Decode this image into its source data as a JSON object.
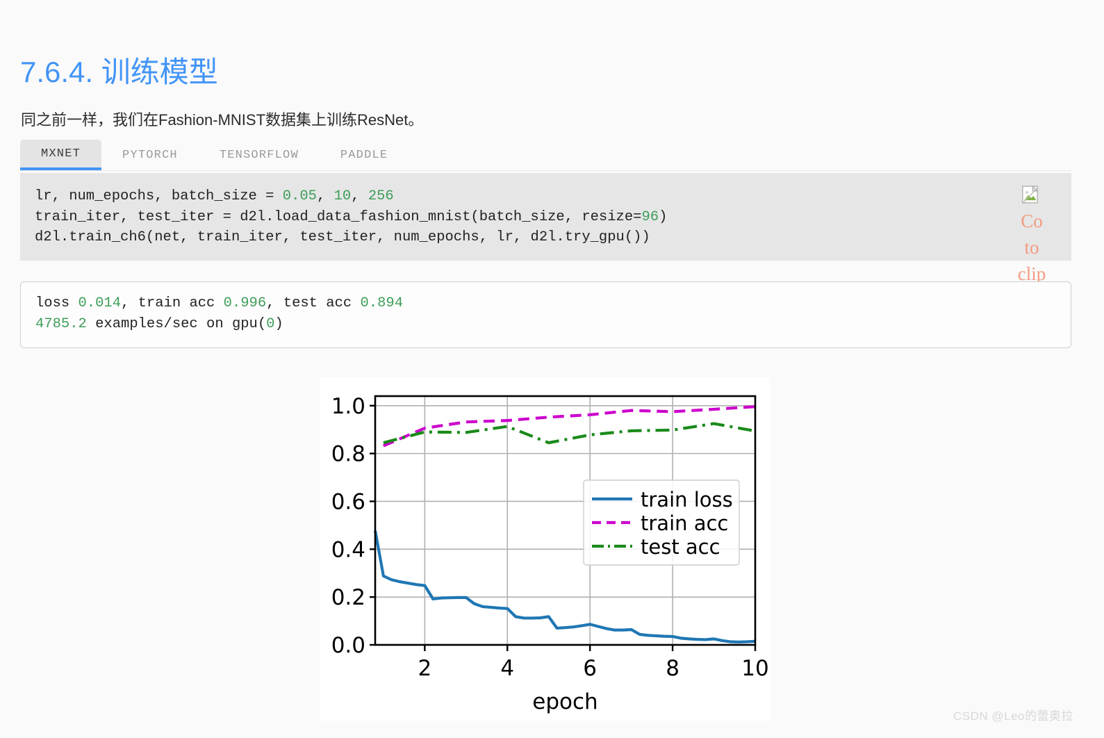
{
  "heading": "7.6.4. 训练模型",
  "paragraph": "同之前一样，我们在Fashion-MNIST数据集上训练ResNet。",
  "tabs": [
    {
      "label": "MXNET",
      "active": true
    },
    {
      "label": "PYTORCH",
      "active": false
    },
    {
      "label": "TENSORFLOW",
      "active": false
    },
    {
      "label": "PADDLE",
      "active": false
    }
  ],
  "code": {
    "line1_a": "lr, num_epochs, batch_size = ",
    "line1_n1": "0.05",
    "line1_b": ", ",
    "line1_n2": "10",
    "line1_c": ", ",
    "line1_n3": "256",
    "line2_a": "train_iter, test_iter = d2l.load_data_fashion_mnist(batch_size, resize=",
    "line2_n1": "96",
    "line2_b": ")",
    "line3": "d2l.train_ch6(net, train_iter, test_iter, num_epochs, lr, d2l.try_gpu())"
  },
  "copy_widget": {
    "icon": "broken-image-icon",
    "text_line1": "Co",
    "text_line2": "to",
    "text_line3": "clip"
  },
  "output": {
    "l1_a": "loss ",
    "l1_n1": "0.014",
    "l1_b": ", train acc ",
    "l1_n2": "0.996",
    "l1_c": ", test acc ",
    "l1_n3": "0.894",
    "l2_n1": "4785.2",
    "l2_a": " examples/sec on gpu(",
    "l2_n2": "0",
    "l2_b": ")"
  },
  "watermark": "CSDN @Leo的蕾奥拉",
  "colors": {
    "heading": "#4294f7",
    "train_loss": "#1f77b4",
    "train_acc": "#cc00cc",
    "test_acc": "#1a8a1a",
    "code_bg": "#e6e6e6",
    "number_token": "#3f9d5a",
    "copy_text": "#f39b82"
  },
  "chart_data": {
    "type": "line",
    "title": "",
    "xlabel": "epoch",
    "ylabel": "",
    "xlim": [
      0.8,
      10.0
    ],
    "ylim": [
      0.0,
      1.04
    ],
    "xticks": [
      2,
      4,
      6,
      8,
      10
    ],
    "yticks": [
      0.0,
      0.2,
      0.4,
      0.6,
      0.8,
      1.0
    ],
    "grid": true,
    "legend_position": "center-right",
    "legend_entries": [
      "train loss",
      "train acc",
      "test acc"
    ],
    "x_fine": [
      0.8,
      1.0,
      1.2,
      1.4,
      1.6,
      1.8,
      2.0,
      2.2,
      2.4,
      2.6,
      2.8,
      3.0,
      3.2,
      3.4,
      3.6,
      3.8,
      4.0,
      4.2,
      4.4,
      4.6,
      4.8,
      5.0,
      5.2,
      5.4,
      5.6,
      5.8,
      6.0,
      6.2,
      6.4,
      6.6,
      6.8,
      7.0,
      7.2,
      7.4,
      7.6,
      7.8,
      8.0,
      8.2,
      8.4,
      8.6,
      8.8,
      9.0,
      9.2,
      9.4,
      9.6,
      9.8,
      10.0
    ],
    "series": [
      {
        "name": "train loss",
        "color": "#1f77b4",
        "style": "solid",
        "values": [
          0.478,
          0.288,
          0.272,
          0.264,
          0.258,
          0.252,
          0.248,
          0.192,
          0.196,
          0.197,
          0.198,
          0.198,
          0.172,
          0.16,
          0.157,
          0.154,
          0.152,
          0.118,
          0.112,
          0.112,
          0.113,
          0.118,
          0.07,
          0.072,
          0.075,
          0.08,
          0.086,
          0.077,
          0.068,
          0.062,
          0.062,
          0.064,
          0.044,
          0.04,
          0.038,
          0.036,
          0.035,
          0.028,
          0.025,
          0.023,
          0.022,
          0.025,
          0.018,
          0.013,
          0.012,
          0.013,
          0.015
        ]
      },
      {
        "name": "train acc",
        "color": "#cc00cc",
        "style": "dashed",
        "x": [
          1,
          2,
          3,
          4,
          5,
          6,
          7,
          8,
          9,
          10
        ],
        "values": [
          0.832,
          0.906,
          0.932,
          0.938,
          0.952,
          0.962,
          0.98,
          0.975,
          0.985,
          0.996
        ]
      },
      {
        "name": "test acc",
        "color": "#1a8a1a",
        "style": "dashdot",
        "x": [
          1,
          2,
          3,
          4,
          5,
          6,
          7,
          8,
          9,
          10
        ],
        "values": [
          0.845,
          0.89,
          0.888,
          0.913,
          0.845,
          0.878,
          0.895,
          0.898,
          0.925,
          0.894
        ]
      }
    ]
  }
}
